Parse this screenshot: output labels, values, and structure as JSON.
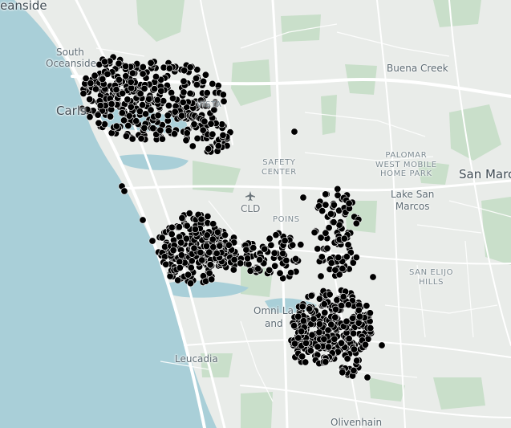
{
  "map": {
    "colors": {
      "water": "#a9cfd8",
      "land": "#e9ece9",
      "park": "#c9dfca",
      "road": "#ffffff",
      "marker": "#000000",
      "marker_stroke": "#ffffff"
    },
    "labels": {
      "oceanside": "eanside",
      "south_oceanside_1": "South",
      "south_oceanside_2": "Oceanside",
      "carlsbad": "Carls",
      "vista": "VISTA",
      "buena_creek": "Buena Creek",
      "palomar_1": "PALOMAR",
      "palomar_2": "WEST MOBILE",
      "palomar_3": "HOME PARK",
      "san_marcos": "San Marco",
      "lake_san_marcos_1": "Lake San",
      "lake_san_marcos_2": "Marcos",
      "safety_center_1": "SAFETY",
      "safety_center_2": "CENTER",
      "cld": "CLD",
      "poinsettia": "POINS",
      "san_elijo_1": "SAN ELIJO",
      "san_elijo_2": "HILLS",
      "omni": "Omni La",
      "omni_2": "and",
      "leucadia": "Leucadia",
      "olivenhain": "Olivenhain"
    },
    "icons": {
      "airport": "airplane-icon"
    }
  }
}
